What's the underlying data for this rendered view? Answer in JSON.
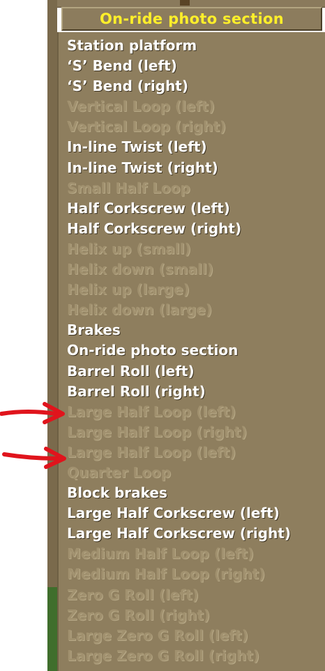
{
  "dropdown": {
    "selected": "On-ride photo section",
    "items": [
      {
        "label": "Station platform",
        "enabled": true
      },
      {
        "label": "‘S’ Bend (left)",
        "enabled": true
      },
      {
        "label": "‘S’ Bend (right)",
        "enabled": true
      },
      {
        "label": "Vertical Loop (left)",
        "enabled": false
      },
      {
        "label": "Vertical Loop (right)",
        "enabled": false
      },
      {
        "label": "In-line Twist (left)",
        "enabled": true
      },
      {
        "label": "In-line Twist (right)",
        "enabled": true
      },
      {
        "label": "Small Half Loop",
        "enabled": false
      },
      {
        "label": "Half Corkscrew (left)",
        "enabled": true
      },
      {
        "label": "Half Corkscrew (right)",
        "enabled": true
      },
      {
        "label": "Helix up (small)",
        "enabled": false
      },
      {
        "label": "Helix down (small)",
        "enabled": false
      },
      {
        "label": "Helix up (large)",
        "enabled": false
      },
      {
        "label": "Helix down (large)",
        "enabled": false
      },
      {
        "label": "Brakes",
        "enabled": true
      },
      {
        "label": "On-ride photo section",
        "enabled": true
      },
      {
        "label": "Barrel Roll (left)",
        "enabled": true
      },
      {
        "label": "Barrel Roll (right)",
        "enabled": true
      },
      {
        "label": "Large Half Loop (left)",
        "enabled": false
      },
      {
        "label": "Large Half Loop (right)",
        "enabled": false
      },
      {
        "label": "Large Half Loop (left)",
        "enabled": false
      },
      {
        "label": "Quarter Loop",
        "enabled": false
      },
      {
        "label": "Block brakes",
        "enabled": true
      },
      {
        "label": "Large Half Corkscrew (left)",
        "enabled": true
      },
      {
        "label": "Large Half Corkscrew (right)",
        "enabled": true
      },
      {
        "label": "Medium Half Loop (left)",
        "enabled": false
      },
      {
        "label": "Medium Half Loop (right)",
        "enabled": false
      },
      {
        "label": "Zero G Roll (left)",
        "enabled": false
      },
      {
        "label": "Zero G Roll (right)",
        "enabled": false
      },
      {
        "label": "Large Zero G Roll (left)",
        "enabled": false
      },
      {
        "label": "Large Zero G Roll (right)",
        "enabled": false
      }
    ]
  },
  "annotations": [
    {
      "type": "red-arrow",
      "points_to_item": 18
    },
    {
      "type": "red-arrow",
      "points_to_item": 20
    }
  ],
  "colors": {
    "selected_text": "#ffef2a",
    "enabled_text": "#ffffff",
    "disabled_text": "#a1916f",
    "panel": "#8e7e5e",
    "annotation": "#e0141c"
  }
}
